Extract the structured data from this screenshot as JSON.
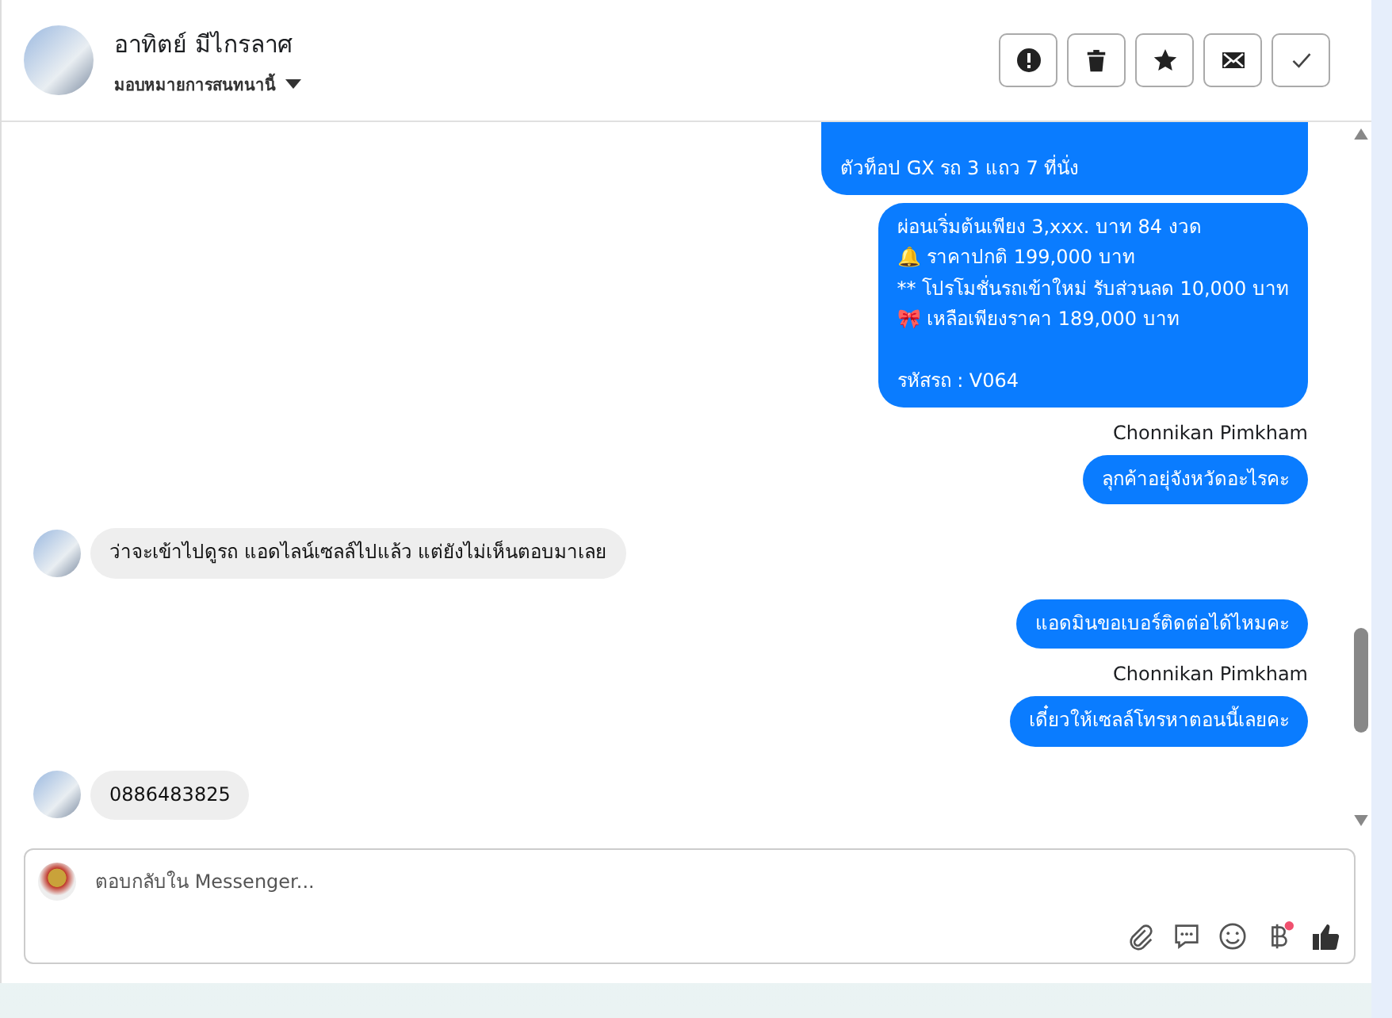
{
  "header": {
    "name": "อาทิตย์ มีไกรลาศ",
    "assign": "มอบหมายการสนทนานี้"
  },
  "actions": [
    {
      "kind": "alert"
    },
    {
      "kind": "trash"
    },
    {
      "kind": "star"
    },
    {
      "kind": "mail"
    },
    {
      "kind": "check"
    }
  ],
  "messages": [
    {
      "kind": "outgoing",
      "text": "ตัวท็อป GX รถ 3 แถว 7 ที่นั่ง",
      "clipped": true
    },
    {
      "kind": "outgoing",
      "text": "ผ่อนเริ่มต้นเพียง 3,xxx. บาท 84 งวด\n🔔 ราคาปกติ 199,000 บาท\n** โปรโมชั่นรถเข้าใหม่ รับส่วนลด 10,000 บาท\n🎀  เหลือเพียงราคา 189,000 บาท\n\n รหัสรถ : V064"
    },
    {
      "kind": "sender",
      "text": "Chonnikan Pimkham"
    },
    {
      "kind": "outgoing",
      "text": "ลุกค้าอยุ่จังหวัดอะไรคะ"
    },
    {
      "kind": "incoming",
      "text": "ว่าจะเข้าไปดูรถ แอดไลน์เซลล์ไปแล้ว แต่ยังไม่เห็นตอบมาเลย"
    },
    {
      "kind": "outgoing",
      "text": "แอดมินขอเบอร์ติดต่อได้ไหมคะ"
    },
    {
      "kind": "sender",
      "text": "Chonnikan Pimkham"
    },
    {
      "kind": "outgoing",
      "text": "เดี๋ยวให้เซลล์โทรหาตอนนี้เลยคะ"
    },
    {
      "kind": "incoming",
      "text": "0886483825"
    }
  ],
  "composer": {
    "placeholder": "ตอบกลับใน Messenger...",
    "tools": [
      {
        "kind": "attach"
      },
      {
        "kind": "chat"
      },
      {
        "kind": "emoji"
      },
      {
        "kind": "baht",
        "badge": true
      },
      {
        "kind": "like"
      }
    ]
  }
}
